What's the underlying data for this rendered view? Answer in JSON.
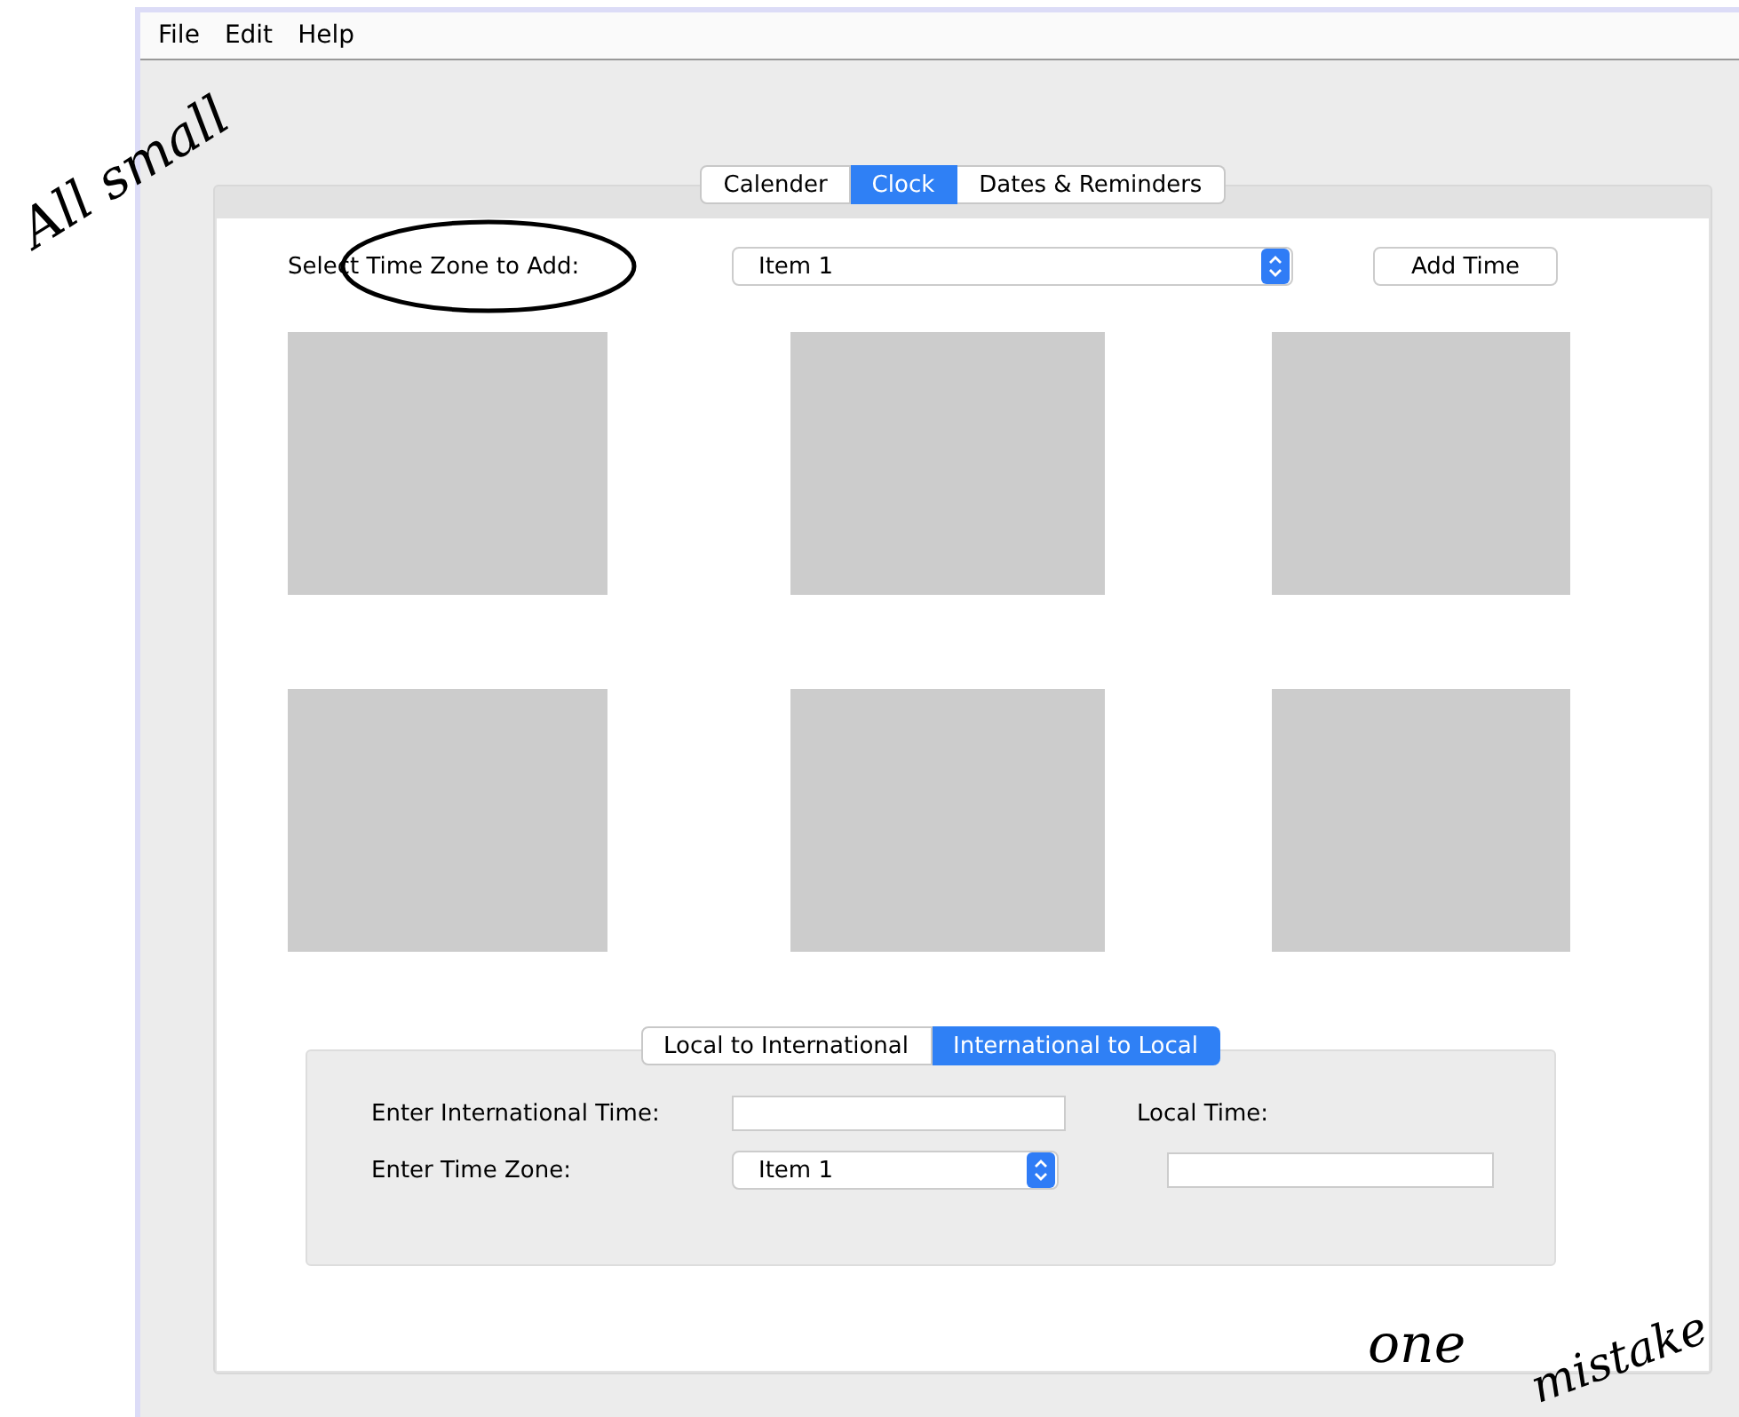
{
  "menu": [
    "File",
    "Edit",
    "Help"
  ],
  "tabs": [
    {
      "label": "Calender",
      "selected": false
    },
    {
      "label": "Clock",
      "selected": true
    },
    {
      "label": "Dates & Reminders",
      "selected": false
    }
  ],
  "clock": {
    "zone_label": "Select Time Zone to Add:",
    "zone_value": "Item 1",
    "add_button": "Add Time",
    "clocks": [
      {
        "kind": "placeholder"
      },
      {
        "kind": "placeholder"
      },
      {
        "kind": "placeholder"
      },
      {
        "kind": "placeholder"
      },
      {
        "kind": "placeholder"
      },
      {
        "kind": "placeholder"
      }
    ]
  },
  "converter": {
    "tabs": [
      {
        "label": "Local to International",
        "selected": false
      },
      {
        "label": "International to Local",
        "selected": true
      }
    ],
    "time_label": "Enter International Time:",
    "zone_label": "Enter Time Zone:",
    "zone_value": "Item 1",
    "result_label": "Local Time:"
  },
  "annotations": [
    {
      "text": "All small"
    },
    {
      "text": "one"
    },
    {
      "text": "mistake"
    }
  ]
}
